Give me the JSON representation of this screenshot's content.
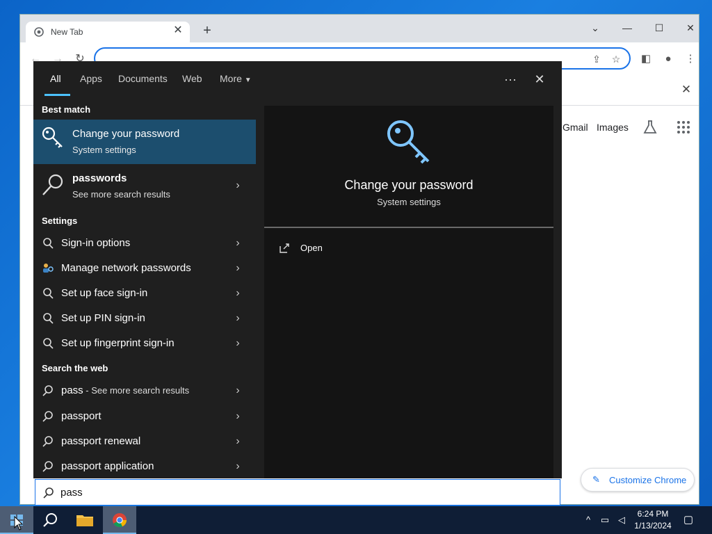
{
  "browser": {
    "tab_title": "New Tab",
    "new_tab": "+",
    "links": {
      "gmail": "Gmail",
      "images": "Images"
    },
    "customize_label": "Customize Chrome"
  },
  "search": {
    "tabs": [
      "All",
      "Apps",
      "Documents",
      "Web",
      "More"
    ],
    "best_match_heading": "Best match",
    "best_match": {
      "title": "Change your password",
      "subtitle": "System settings",
      "icon": "key-icon"
    },
    "web_best": {
      "title": "passwords",
      "subtitle": "See more search results"
    },
    "settings_heading": "Settings",
    "settings_items": [
      "Sign-in options",
      "Manage network passwords",
      "Set up face sign-in",
      "Set up PIN sign-in",
      "Set up fingerprint sign-in"
    ],
    "web_heading": "Search the web",
    "web_items": [
      {
        "text": "pass",
        "suffix": " - See more search results"
      },
      {
        "text": "passport",
        "suffix": ""
      },
      {
        "text": "passport renewal",
        "suffix": ""
      },
      {
        "text": "passport application",
        "suffix": ""
      }
    ],
    "preview": {
      "title": "Change your password",
      "subtitle": "System settings",
      "action": "Open"
    },
    "query": "pass"
  },
  "taskbar": {
    "time": "6:24 PM",
    "date": "1/13/2024"
  },
  "colors": {
    "accent": "#4cc2ff",
    "best_match_bg": "#1c4e6e",
    "panel_bg": "#1f1f1f",
    "taskbar_bg": "#0f1e36"
  }
}
